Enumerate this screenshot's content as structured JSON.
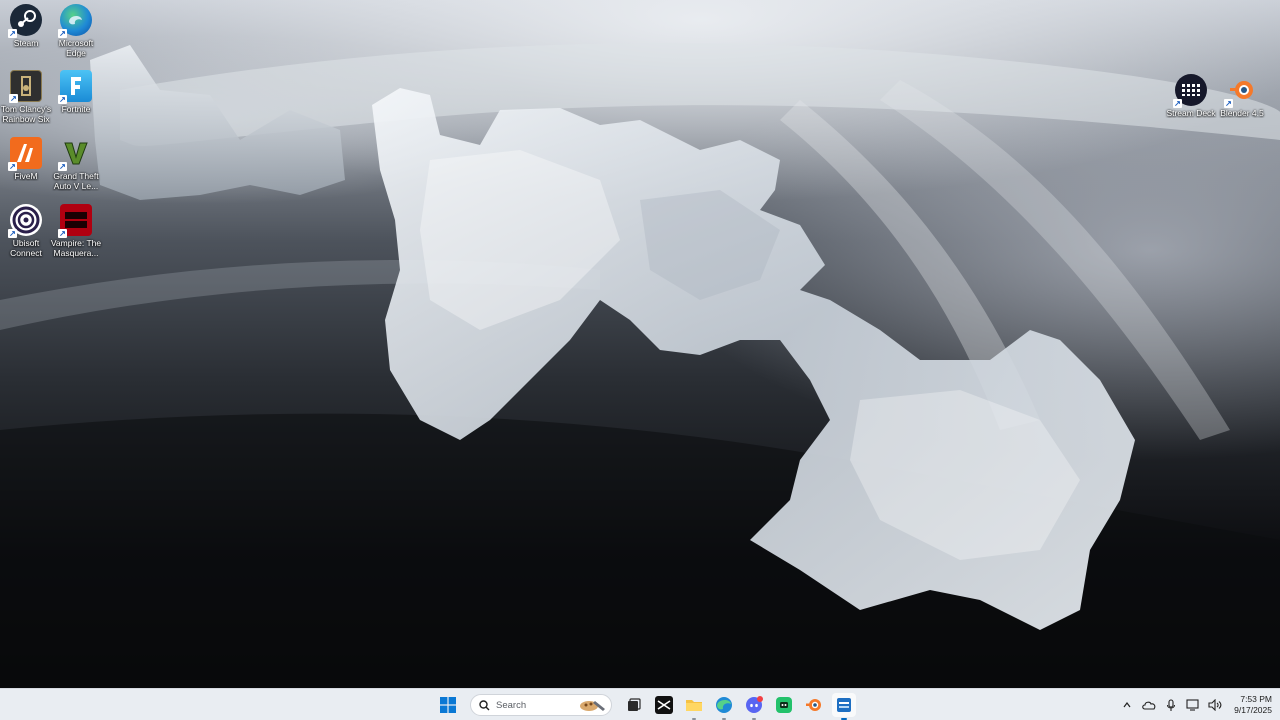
{
  "desktop": {
    "icons": [
      {
        "label": "Steam",
        "icon": "steam-icon",
        "color": "#1b2838"
      },
      {
        "label": "Microsoft Edge",
        "icon": "edge-icon",
        "color": "#1f8ad6"
      },
      {
        "label": "Tom Clancy's Rainbow Six",
        "icon": "rainbow-six-icon",
        "color": "#3a3a3a"
      },
      {
        "label": "Fortnite",
        "icon": "fortnite-icon",
        "color": "#2aa7e8"
      },
      {
        "label": "FiveM",
        "icon": "fivem-icon",
        "color": "#f26b1d"
      },
      {
        "label": "Grand Theft Auto V Le...",
        "icon": "gta-v-icon",
        "color": "#5a8c2a"
      },
      {
        "label": "Ubisoft Connect",
        "icon": "ubisoft-connect-icon",
        "color": "#ffffff"
      },
      {
        "label": "Vampire: The Masquera...",
        "icon": "bloodhunt-icon",
        "color": "#b00010"
      },
      {
        "label": "Stream Deck",
        "icon": "stream-deck-icon",
        "color": "#16182a"
      },
      {
        "label": "Blender 4.5",
        "icon": "blender-icon",
        "color": "#f5792a"
      }
    ]
  },
  "taskbar": {
    "search_placeholder": "Search",
    "items": [
      {
        "name": "start",
        "icon": "windows-start-icon"
      },
      {
        "name": "task-view",
        "icon": "task-view-icon"
      },
      {
        "name": "capcut",
        "icon": "capcut-icon"
      },
      {
        "name": "file-explorer",
        "icon": "folder-icon"
      },
      {
        "name": "edge",
        "icon": "edge-icon"
      },
      {
        "name": "discord",
        "icon": "discord-icon"
      },
      {
        "name": "game-app",
        "icon": "green-game-icon"
      },
      {
        "name": "blender",
        "icon": "blender-icon"
      },
      {
        "name": "active-app",
        "icon": "app-window-icon"
      }
    ],
    "tray": {
      "time": "7:53 PM",
      "date": "9/17/2025",
      "icons": [
        "chevron-up-icon",
        "onedrive-icon",
        "microphone-icon",
        "display-icon",
        "volume-icon"
      ]
    }
  },
  "colors": {
    "taskbar_bg": "#e9edf2",
    "accent": "#0067c0"
  }
}
